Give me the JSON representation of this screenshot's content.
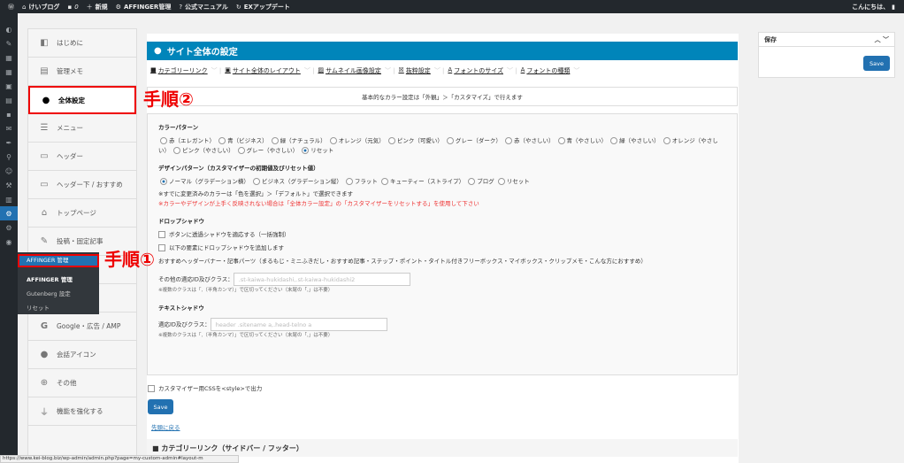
{
  "adminbar": {
    "site": "けいブログ",
    "comments": "0",
    "new": "新規",
    "affinger": "AFFINGER管理",
    "manual": "公式マニュアル",
    "ex": "EXアップデート",
    "greeting": "こんにちは、"
  },
  "setnav": [
    "はじめに",
    "管理メモ",
    "全体設定",
    "メニュー",
    "ヘッダー",
    "ヘッダー下 / おすすめ",
    "トップページ",
    "投稿・固定記事",
    "",
    "",
    "Google・広告 / AMP",
    "会話アイコン",
    "その他",
    "機能を強化する"
  ],
  "flyout": {
    "current": "AFFINGER 管理",
    "items": [
      "AFFINGER 管理",
      "Gutenberg 設定",
      "リセット"
    ]
  },
  "steps": {
    "one": "手順①",
    "two": "手順②"
  },
  "main": {
    "title": "サイト全体の設定",
    "tabs": [
      "カテゴリーリンク",
      "サイト全体のレイアウト",
      "サムネイル画像設定",
      "抜粋設定",
      "フォントのサイズ",
      "フォントの種類"
    ],
    "notice": "基本的なカラー設定は「外観」＞「カスタマイズ」で行えます",
    "color_heading": "カラーパターン",
    "color_options": [
      "赤（エレガント）",
      "青（ビジネス）",
      "緑（ナチュラル）",
      "オレンジ（元気）",
      "ピンク（可愛い）",
      "グレー（ダーク）",
      "赤（やさしい）",
      "青（やさしい）",
      "緑（やさしい）",
      "オレンジ（やさしい）",
      "ピンク（やさしい）",
      "グレー（やさしい）",
      "リセット"
    ],
    "design_heading": "デザインパターン（カスタマイザーの初期値及びリセット値）",
    "design_options": [
      "ノーマル（グラデーション横）",
      "ビジネス（グラデーション縦）",
      "フラット",
      "キューティー（ストライプ）",
      "ブログ",
      "リセット"
    ],
    "design_note": "※すでに変更済みのカラーは「色を選択」＞「デフォルト」で選択できます",
    "design_warning": "※カラーやデザインが上手く反映されない場合は「全体カラー設定」の「カスタマイザーをリセットする」を使用して下さい",
    "drop_heading": "ドロップシャドウ",
    "drop_cb1": "ボタンに透過シャドウを適応する（一括強制）",
    "drop_cb2": "以下の要素にドロップシャドウを追加します",
    "drop_desc": "おすすめヘッダーバナー・記事パーツ（まるもじ・ミニふきだし・おすすめ記事・ステップ・ポイント・タイトル付きフリーボックス・マイボックス・クリップメモ・こんな方におすすめ）",
    "drop_label": "その他の適応ID及びクラス：",
    "drop_placeholder": ".st-kaiwa-hukidashi,.st-kaiwa-hukidashi2",
    "class_note": "※複数のクラスは「,（半角カンマ）」で区切ってください（末尾の「,」は不要）",
    "text_heading": "テキストシャドウ",
    "text_label": "適応ID及びクラス：",
    "text_placeholder": "header .sitename a,.head-telno a",
    "css_cb": "カスタマイザー用CSSを<style>で出力",
    "save": "保存",
    "save_btn": "Save",
    "back_top": "先頭に戻る",
    "next_section": "カテゴリーリンク（サイドバー / フッター）"
  },
  "savebox": {
    "title": "保存",
    "button": "Save"
  },
  "status_url": "https://www.kei-blog.biz/wp-admin/admin.php?page=my-custom-admin#layout-m"
}
